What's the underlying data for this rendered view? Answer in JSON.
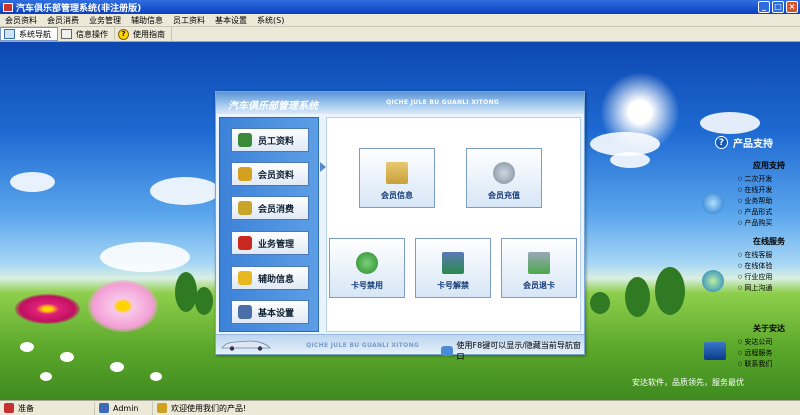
{
  "window": {
    "title": "汽车俱乐部管理系统(非注册版)"
  },
  "menu": [
    "会员资料",
    "会员消费",
    "业务管理",
    "辅助信息",
    "员工资料",
    "基本设置",
    "系统(S)"
  ],
  "toolbar": [
    {
      "label": "系统导航",
      "icon": "navigation-icon"
    },
    {
      "label": "信息操作",
      "icon": "info-window-icon"
    },
    {
      "label": "使用指南",
      "icon": "help-icon"
    }
  ],
  "panel": {
    "title": "汽车俱乐部管理系统",
    "subtitle": "QICHE JULE BU GUANLI XITONG",
    "nav": [
      {
        "label": "员工资料",
        "icon": "employee-icon",
        "color": "#3a8a3a"
      },
      {
        "label": "会员资料",
        "icon": "member-icon",
        "color": "#d4a020"
      },
      {
        "label": "会员消费",
        "icon": "consume-icon",
        "color": "#c8a428"
      },
      {
        "label": "业务管理",
        "icon": "business-icon",
        "color": "#c8281e"
      },
      {
        "label": "辅助信息",
        "icon": "star-icon",
        "color": "#e8b820"
      },
      {
        "label": "基本设置",
        "icon": "settings-icon",
        "color": "#4a6ea8"
      }
    ],
    "tiles": [
      {
        "label": "会员信息",
        "icon": "folder-icon",
        "color": "#c9a03a"
      },
      {
        "label": "会员充值",
        "icon": "recharge-icon",
        "color": "#7a8a9a"
      },
      {
        "label": "卡号禁用",
        "icon": "user-block-icon",
        "color": "#3a9a3a"
      },
      {
        "label": "卡号解禁",
        "icon": "unlock-icon",
        "color": "#2a8a4a"
      },
      {
        "label": "会员退卡",
        "icon": "return-card-icon",
        "color": "#4aa84a"
      }
    ],
    "footer_subtitle": "QICHE JULE BU GUANLI XITONG",
    "footer_hint": "使用F8键可以显示/隐藏当前导航窗口"
  },
  "side": {
    "title": "产品支持",
    "sections": [
      {
        "heading": "应用支持",
        "links": [
          "二次开发",
          "在线开发",
          "业务帮助",
          "产品形式",
          "产品购买"
        ]
      },
      {
        "heading": "在线服务",
        "links": [
          "在线客服",
          "在线体验",
          "行业应用",
          "网上沟通"
        ]
      },
      {
        "heading": "关于安达",
        "links": [
          "安达公司",
          "远程服务",
          "联系我们"
        ]
      }
    ]
  },
  "bottom_note": "安达软件，品质领先，服务最优",
  "status": {
    "ready": "准备",
    "user": "Admin",
    "welcome": "欢迎使用我们的产品!"
  },
  "colors": {
    "titlebar": "#0a3fbf",
    "accent": "#3c82d8"
  }
}
